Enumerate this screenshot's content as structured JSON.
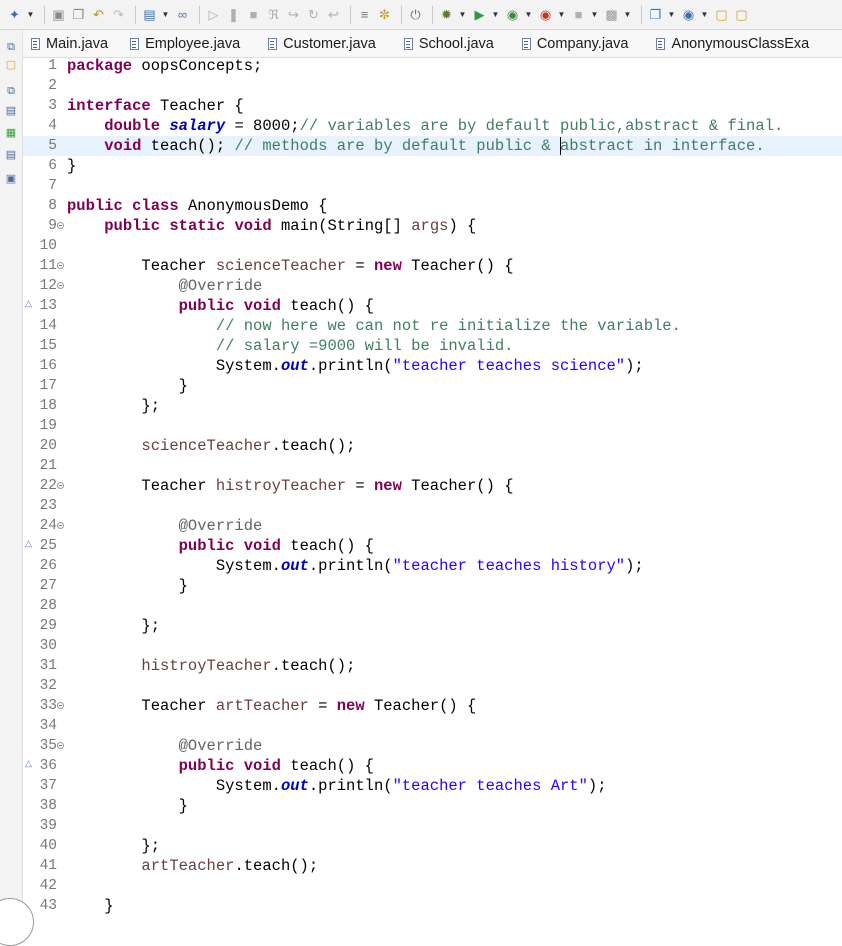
{
  "toolbar": {
    "icons": [
      "new-icon",
      "save-icon",
      "save-all-icon",
      "undo-icon",
      "redo-icon",
      "console-icon",
      "link-icon",
      "resume-icon",
      "suspend-icon",
      "terminate-icon",
      "disconnect-icon",
      "step-into-icon",
      "step-over-icon",
      "step-return-icon",
      "use-step-filters-icon",
      "skip-breakpoints-icon",
      "spring-boot-icon",
      "debug-icon",
      "run-icon",
      "coverage-icon",
      "external-tools-icon",
      "stop-icon",
      "build-icon",
      "new-server-icon",
      "sts-icon",
      "open-folder-icon",
      "open-type-icon"
    ]
  },
  "tabs": [
    {
      "label": "Main.java"
    },
    {
      "label": "Employee.java"
    },
    {
      "label": "Customer.java"
    },
    {
      "label": "School.java"
    },
    {
      "label": "Company.java"
    },
    {
      "label": "AnonymousClassExa"
    }
  ],
  "editor": {
    "current_line": 5,
    "lines": [
      {
        "n": "1",
        "fold": "",
        "tokens": [
          {
            "c": "keyword",
            "t": "package"
          },
          {
            "c": "plain",
            "t": " oopsConcepts;"
          }
        ]
      },
      {
        "n": "2",
        "fold": "",
        "tokens": []
      },
      {
        "n": "3",
        "fold": "",
        "tokens": [
          {
            "c": "keyword",
            "t": "interface"
          },
          {
            "c": "plain",
            "t": " Teacher {"
          }
        ]
      },
      {
        "n": "4",
        "fold": "",
        "tokens": [
          {
            "c": "plain",
            "t": "    "
          },
          {
            "c": "keyword",
            "t": "double"
          },
          {
            "c": "plain",
            "t": " "
          },
          {
            "c": "field",
            "t": "salary"
          },
          {
            "c": "plain",
            "t": " = 8000;"
          },
          {
            "c": "comment",
            "t": "// variables are by default public,abstract & final."
          }
        ]
      },
      {
        "n": "5",
        "fold": "",
        "tokens": [
          {
            "c": "plain",
            "t": "    "
          },
          {
            "c": "keyword",
            "t": "void"
          },
          {
            "c": "plain",
            "t": " teach(); "
          },
          {
            "c": "comment",
            "t": "// methods are by default public & abstract in interface."
          }
        ]
      },
      {
        "n": "6",
        "fold": "",
        "tokens": [
          {
            "c": "plain",
            "t": "}"
          }
        ]
      },
      {
        "n": "7",
        "fold": "",
        "tokens": []
      },
      {
        "n": "8",
        "fold": "",
        "tokens": [
          {
            "c": "keyword",
            "t": "public"
          },
          {
            "c": "plain",
            "t": " "
          },
          {
            "c": "keyword",
            "t": "class"
          },
          {
            "c": "plain",
            "t": " AnonymousDemo {"
          }
        ]
      },
      {
        "n": "9",
        "fold": "fold",
        "tokens": [
          {
            "c": "plain",
            "t": "    "
          },
          {
            "c": "keyword",
            "t": "public"
          },
          {
            "c": "plain",
            "t": " "
          },
          {
            "c": "keyword",
            "t": "static"
          },
          {
            "c": "plain",
            "t": " "
          },
          {
            "c": "keyword",
            "t": "void"
          },
          {
            "c": "plain",
            "t": " main(String[] "
          },
          {
            "c": "variable",
            "t": "args"
          },
          {
            "c": "plain",
            "t": ") {"
          }
        ]
      },
      {
        "n": "10",
        "fold": "",
        "tokens": []
      },
      {
        "n": "11",
        "fold": "fold",
        "tokens": [
          {
            "c": "plain",
            "t": "        Teacher "
          },
          {
            "c": "variable",
            "t": "scienceTeacher"
          },
          {
            "c": "plain",
            "t": " = "
          },
          {
            "c": "keyword",
            "t": "new"
          },
          {
            "c": "plain",
            "t": " Teacher() {"
          }
        ]
      },
      {
        "n": "12",
        "fold": "fold",
        "tokens": [
          {
            "c": "plain",
            "t": "            "
          },
          {
            "c": "annotation",
            "t": "@Override"
          }
        ]
      },
      {
        "n": "13",
        "fold": "override",
        "tokens": [
          {
            "c": "plain",
            "t": "            "
          },
          {
            "c": "keyword",
            "t": "public"
          },
          {
            "c": "plain",
            "t": " "
          },
          {
            "c": "keyword",
            "t": "void"
          },
          {
            "c": "plain",
            "t": " teach() {"
          }
        ]
      },
      {
        "n": "14",
        "fold": "",
        "tokens": [
          {
            "c": "plain",
            "t": "                "
          },
          {
            "c": "comment",
            "t": "// now here we can not re initialize the variable."
          }
        ]
      },
      {
        "n": "15",
        "fold": "",
        "tokens": [
          {
            "c": "plain",
            "t": "                "
          },
          {
            "c": "comment",
            "t": "// salary =9000 will be invalid."
          }
        ]
      },
      {
        "n": "16",
        "fold": "",
        "tokens": [
          {
            "c": "plain",
            "t": "                System."
          },
          {
            "c": "field",
            "t": "out"
          },
          {
            "c": "plain",
            "t": ".println("
          },
          {
            "c": "string",
            "t": "\"teacher teaches science\""
          },
          {
            "c": "plain",
            "t": ");"
          }
        ]
      },
      {
        "n": "17",
        "fold": "",
        "tokens": [
          {
            "c": "plain",
            "t": "            }"
          }
        ]
      },
      {
        "n": "18",
        "fold": "",
        "tokens": [
          {
            "c": "plain",
            "t": "        };"
          }
        ]
      },
      {
        "n": "19",
        "fold": "",
        "tokens": []
      },
      {
        "n": "20",
        "fold": "",
        "tokens": [
          {
            "c": "plain",
            "t": "        "
          },
          {
            "c": "variable",
            "t": "scienceTeacher"
          },
          {
            "c": "plain",
            "t": ".teach();"
          }
        ]
      },
      {
        "n": "21",
        "fold": "",
        "tokens": []
      },
      {
        "n": "22",
        "fold": "fold",
        "tokens": [
          {
            "c": "plain",
            "t": "        Teacher "
          },
          {
            "c": "variable",
            "t": "histroyTeacher"
          },
          {
            "c": "plain",
            "t": " = "
          },
          {
            "c": "keyword",
            "t": "new"
          },
          {
            "c": "plain",
            "t": " Teacher() {"
          }
        ]
      },
      {
        "n": "23",
        "fold": "",
        "tokens": []
      },
      {
        "n": "24",
        "fold": "fold",
        "tokens": [
          {
            "c": "plain",
            "t": "            "
          },
          {
            "c": "annotation",
            "t": "@Override"
          }
        ]
      },
      {
        "n": "25",
        "fold": "override",
        "tokens": [
          {
            "c": "plain",
            "t": "            "
          },
          {
            "c": "keyword",
            "t": "public"
          },
          {
            "c": "plain",
            "t": " "
          },
          {
            "c": "keyword",
            "t": "void"
          },
          {
            "c": "plain",
            "t": " teach() {"
          }
        ]
      },
      {
        "n": "26",
        "fold": "",
        "tokens": [
          {
            "c": "plain",
            "t": "                System."
          },
          {
            "c": "field",
            "t": "out"
          },
          {
            "c": "plain",
            "t": ".println("
          },
          {
            "c": "string",
            "t": "\"teacher teaches history\""
          },
          {
            "c": "plain",
            "t": ");"
          }
        ]
      },
      {
        "n": "27",
        "fold": "",
        "tokens": [
          {
            "c": "plain",
            "t": "            }"
          }
        ]
      },
      {
        "n": "28",
        "fold": "",
        "tokens": []
      },
      {
        "n": "29",
        "fold": "",
        "tokens": [
          {
            "c": "plain",
            "t": "        };"
          }
        ]
      },
      {
        "n": "30",
        "fold": "",
        "tokens": []
      },
      {
        "n": "31",
        "fold": "",
        "tokens": [
          {
            "c": "plain",
            "t": "        "
          },
          {
            "c": "variable",
            "t": "histroyTeacher"
          },
          {
            "c": "plain",
            "t": ".teach();"
          }
        ]
      },
      {
        "n": "32",
        "fold": "",
        "tokens": []
      },
      {
        "n": "33",
        "fold": "fold",
        "tokens": [
          {
            "c": "plain",
            "t": "        Teacher "
          },
          {
            "c": "variable",
            "t": "artTeacher"
          },
          {
            "c": "plain",
            "t": " = "
          },
          {
            "c": "keyword",
            "t": "new"
          },
          {
            "c": "plain",
            "t": " Teacher() {"
          }
        ]
      },
      {
        "n": "34",
        "fold": "",
        "tokens": []
      },
      {
        "n": "35",
        "fold": "fold",
        "tokens": [
          {
            "c": "plain",
            "t": "            "
          },
          {
            "c": "annotation",
            "t": "@Override"
          }
        ]
      },
      {
        "n": "36",
        "fold": "override",
        "tokens": [
          {
            "c": "plain",
            "t": "            "
          },
          {
            "c": "keyword",
            "t": "public"
          },
          {
            "c": "plain",
            "t": " "
          },
          {
            "c": "keyword",
            "t": "void"
          },
          {
            "c": "plain",
            "t": " teach() {"
          }
        ]
      },
      {
        "n": "37",
        "fold": "",
        "tokens": [
          {
            "c": "plain",
            "t": "                System."
          },
          {
            "c": "field",
            "t": "out"
          },
          {
            "c": "plain",
            "t": ".println("
          },
          {
            "c": "string",
            "t": "\"teacher teaches Art\""
          },
          {
            "c": "plain",
            "t": ");"
          }
        ]
      },
      {
        "n": "38",
        "fold": "",
        "tokens": [
          {
            "c": "plain",
            "t": "            }"
          }
        ]
      },
      {
        "n": "39",
        "fold": "",
        "tokens": []
      },
      {
        "n": "40",
        "fold": "",
        "tokens": [
          {
            "c": "plain",
            "t": "        };"
          }
        ]
      },
      {
        "n": "41",
        "fold": "",
        "tokens": [
          {
            "c": "plain",
            "t": "        "
          },
          {
            "c": "variable",
            "t": "artTeacher"
          },
          {
            "c": "plain",
            "t": ".teach();"
          }
        ]
      },
      {
        "n": "42",
        "fold": "",
        "tokens": []
      },
      {
        "n": "43",
        "fold": "",
        "tokens": [
          {
            "c": "plain",
            "t": "    }"
          }
        ]
      }
    ]
  },
  "colors": {
    "keyword": "#7f0055",
    "field": "#0000c0",
    "comment": "#3f7f5f",
    "string": "#2a00ff",
    "annotation": "#646464",
    "variable": "#6a3e3e",
    "current_line": "#e8f2fe"
  }
}
